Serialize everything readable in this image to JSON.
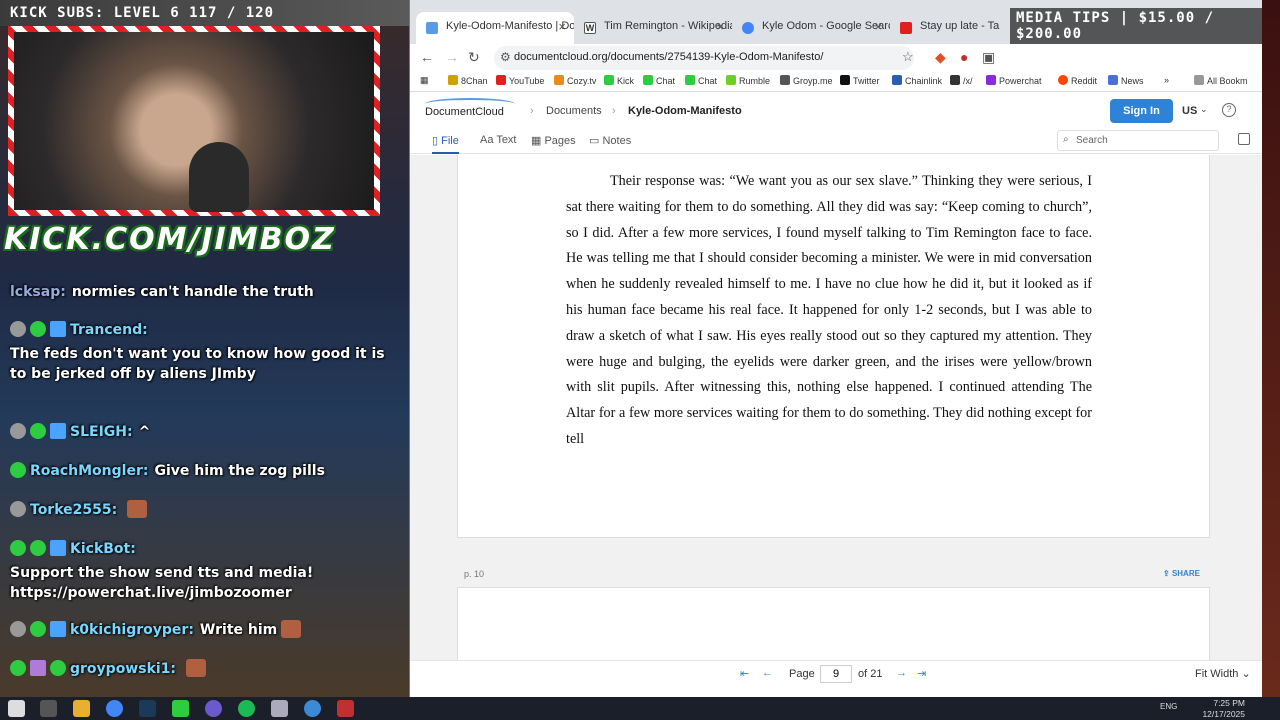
{
  "overlay": {
    "subs_banner": "KICK SUBS: LEVEL 6 117 / 120",
    "channel_url": "KICK.COM/JIMBOZ",
    "media_tips": "MEDIA TIPS | $15.00 / $200.00"
  },
  "chat": [
    {
      "name": "lcksap:",
      "message": "normies can't handle the truth"
    },
    {
      "name": "Trancend:",
      "message": ""
    },
    {
      "name": "",
      "message": "The feds don't want you to know how good it is to be jerked off by aliens JImby"
    },
    {
      "name": "SLEIGH:",
      "message": "^"
    },
    {
      "name": "RoachMongler:",
      "message": "Give him the zog pills"
    },
    {
      "name": "Torke2555:",
      "message": ""
    },
    {
      "name": "KickBot:",
      "message": ""
    },
    {
      "name": "",
      "message": "Support the show send tts and media! https://powerchat.live/jimbozoomer"
    },
    {
      "name": "k0kichigroyper:",
      "message": "Write him"
    },
    {
      "name": "groypowski1:",
      "message": ""
    }
  ],
  "browser": {
    "tabs": [
      {
        "title": "Kyle-Odom-Manifesto | Docum",
        "active": true
      },
      {
        "title": "Tim Remington - Wikipedia",
        "active": false
      },
      {
        "title": "Kyle Odom - Google Search",
        "active": false
      },
      {
        "title": "Stay up late - Talking",
        "active": false
      }
    ],
    "url": "documentcloud.org/documents/2754139-Kyle-Odom-Manifesto/",
    "bookmarks": [
      "8Chan",
      "YouTube",
      "Cozy.tv",
      "Kick",
      "Chat",
      "Chat",
      "Rumble",
      "Groyp.me",
      "Twitter",
      "Chainlink",
      "/x/",
      "Powerchat",
      "Reddit",
      "News",
      "All Bookm"
    ]
  },
  "documentcloud": {
    "logo": "DocumentCloud",
    "breadcrumbs": [
      "Documents",
      "Kyle-Odom-Manifesto"
    ],
    "sign_in": "Sign In",
    "language": "US",
    "tabs": [
      "File",
      "Text",
      "Pages",
      "Notes"
    ],
    "search_placeholder": "Search",
    "page_text": "Their response was: “We want you as our sex slave.” Thinking they were serious, I sat there waiting for them to do something. All they did was say: “Keep coming to church”, so I did. After a few more services, I found myself talking to Tim Remington face to face. He was telling me that I should consider becoming a minister. We were in mid conversation when he suddenly revealed himself to me. I have no clue how he did it, but it looked as if his human face became his real face. It happened for only 1-2 seconds, but I was able to draw a sketch of what I saw. His eyes really stood out so they captured my attention. They were huge and bulging, the eyelids were darker green, and the irises were yellow/brown with slit pupils. After witnessing this, nothing else happened. I continued attending The Altar for a few more services waiting for them to do something. They did nothing except for tell",
    "next_page_label": "p. 10",
    "share_label": "SHARE",
    "pager": {
      "label": "Page",
      "current": "9",
      "total": "of 21",
      "zoom": "Fit Width"
    }
  },
  "taskbar": {
    "language": "ENG",
    "time": "7:25 PM",
    "date": "12/17/2025"
  }
}
